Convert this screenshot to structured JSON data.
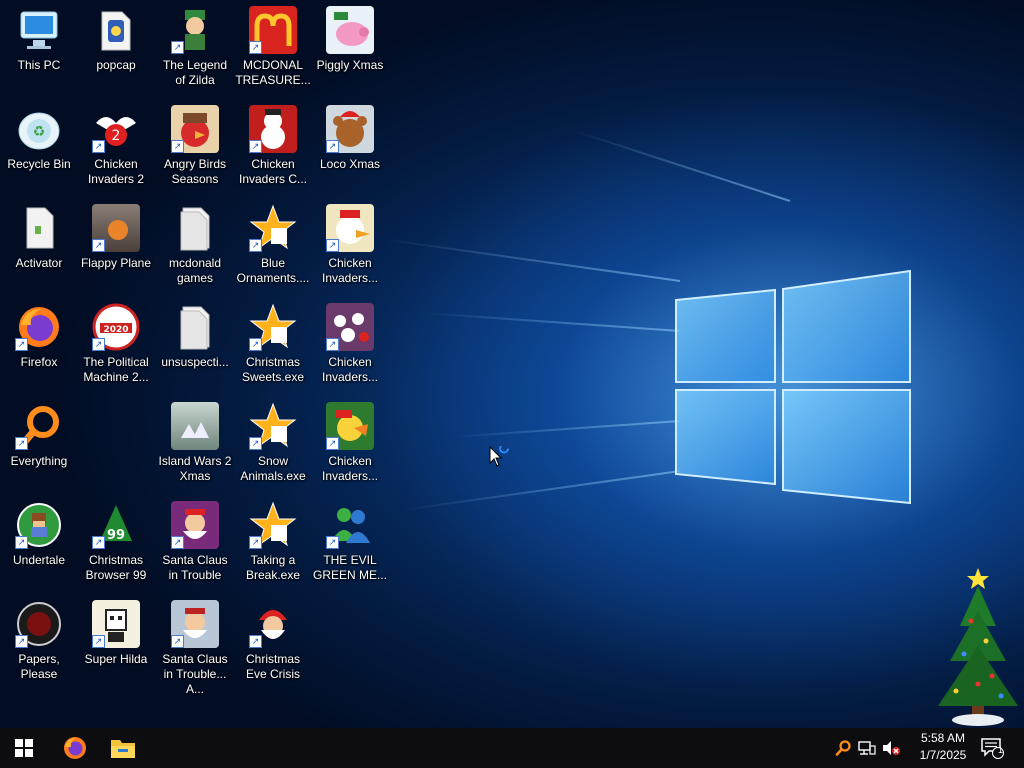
{
  "desktop": {
    "icons": [
      {
        "label": "This PC",
        "glyph": "pc-icon"
      },
      {
        "label": "Recycle Bin",
        "glyph": "recycle-bin-icon"
      },
      {
        "label": "Activator",
        "glyph": "file-icon"
      },
      {
        "label": "Firefox",
        "glyph": "firefox-icon"
      },
      {
        "label": "Everything",
        "glyph": "search-magnifier-icon"
      },
      {
        "label": "Undertale",
        "glyph": "undertale-icon"
      },
      {
        "label": "Papers, Please",
        "glyph": "papers-please-icon"
      },
      {
        "label": "popcap",
        "glyph": "folder-icon"
      },
      {
        "label": "Chicken Invaders 2",
        "glyph": "chicken-icon"
      },
      {
        "label": "Flappy Plane",
        "glyph": "game-thumbnail-icon"
      },
      {
        "label": "The Political Machine 2...",
        "glyph": "political-machine-icon"
      },
      {
        "label": "Christmas Browser 99",
        "glyph": "christmas-tree-icon"
      },
      {
        "label": "Super Hilda",
        "glyph": "pixel-game-icon"
      },
      {
        "label": "The Legend of Zilda",
        "glyph": "game-character-icon"
      },
      {
        "label": "Angry Birds Seasons",
        "glyph": "angry-birds-icon"
      },
      {
        "label": "mcdonald games",
        "glyph": "folder-icon"
      },
      {
        "label": "unsuspecti...",
        "glyph": "folder-icon"
      },
      {
        "label": "Island Wars 2 Xmas",
        "glyph": "game-thumbnail-icon"
      },
      {
        "label": "Santa Claus in Trouble",
        "glyph": "santa-icon"
      },
      {
        "label": "Santa Claus in Trouble... A...",
        "glyph": "santa-icon"
      },
      {
        "label": "MCDONAL TREASURE...",
        "glyph": "mcdonalds-icon"
      },
      {
        "label": "Chicken Invaders C...",
        "glyph": "snowman-icon"
      },
      {
        "label": "Blue Ornaments....",
        "glyph": "exe-star-icon"
      },
      {
        "label": "Christmas Sweets.exe",
        "glyph": "exe-star-icon"
      },
      {
        "label": "Snow Animals.exe",
        "glyph": "exe-star-icon"
      },
      {
        "label": "Taking a Break.exe",
        "glyph": "exe-star-icon"
      },
      {
        "label": "Christmas Eve Crisis",
        "glyph": "santa-icon"
      },
      {
        "label": "Piggly Xmas",
        "glyph": "pig-icon"
      },
      {
        "label": "Loco Xmas",
        "glyph": "bear-icon"
      },
      {
        "label": "Chicken Invaders...",
        "glyph": "chicken-icon"
      },
      {
        "label": "Chicken Invaders...",
        "glyph": "chicken-icon"
      },
      {
        "label": "Chicken Invaders...",
        "glyph": "chicken-icon"
      },
      {
        "label": "THE EVIL GREEN ME...",
        "glyph": "messenger-icon"
      }
    ]
  },
  "taskbar": {
    "clock_time": "5:58 AM",
    "clock_date": "1/7/2025",
    "notification_count": "1"
  },
  "colors": {
    "taskbar": "#0d0d10",
    "accent_blue": "#0b4fa8"
  }
}
